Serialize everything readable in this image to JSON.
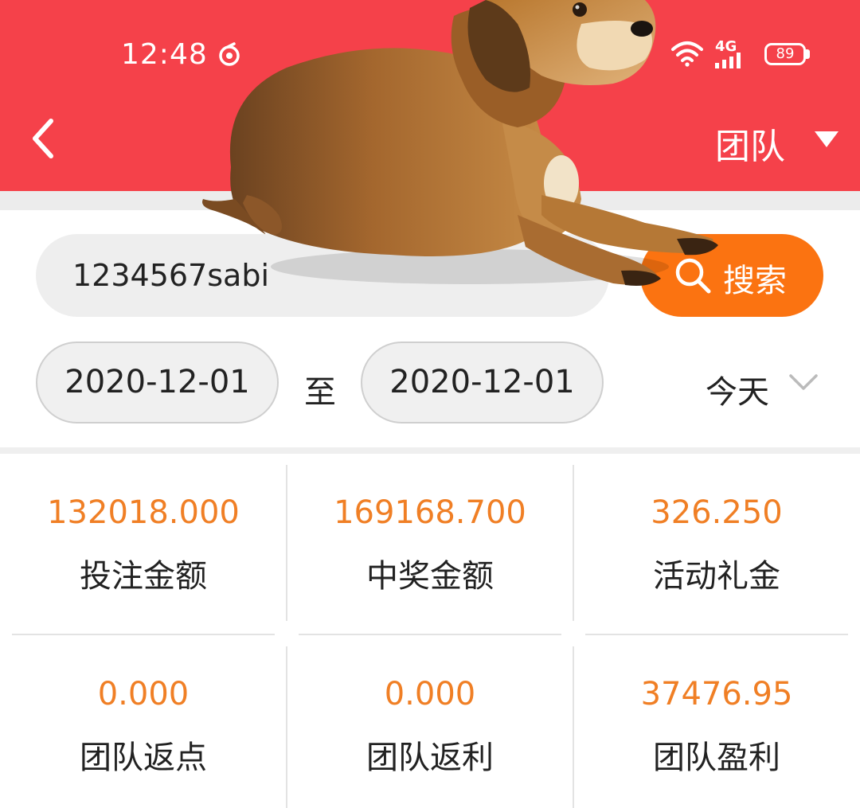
{
  "status_bar": {
    "time": "12:48",
    "network": "4G",
    "battery": "89",
    "icons": [
      "app-notification-icon",
      "wifi-icon",
      "signal-icon",
      "battery-icon"
    ]
  },
  "header": {
    "back_icon": "chevron-left-icon",
    "mode_label": "团队",
    "mode_caret_icon": "caret-down-icon"
  },
  "search": {
    "value": "1234567sabi",
    "button_label": "搜索",
    "button_icon": "search-icon"
  },
  "date_filter": {
    "start": "2020-12-01",
    "separator": "至",
    "end": "2020-12-01",
    "range_label": "今天",
    "range_icon": "chevron-down-icon"
  },
  "stats": [
    {
      "value": "132018.000",
      "label": "投注金额"
    },
    {
      "value": "169168.700",
      "label": "中奖金额"
    },
    {
      "value": "326.250",
      "label": "活动礼金"
    },
    {
      "value": "0.000",
      "label": "团队返点"
    },
    {
      "value": "0.000",
      "label": "团队返利"
    },
    {
      "value": "37476.95",
      "label": "团队盈利"
    }
  ],
  "colors": {
    "header_bg": "#f5414a",
    "accent_orange": "#fb7311",
    "value_orange": "#f07f25"
  }
}
